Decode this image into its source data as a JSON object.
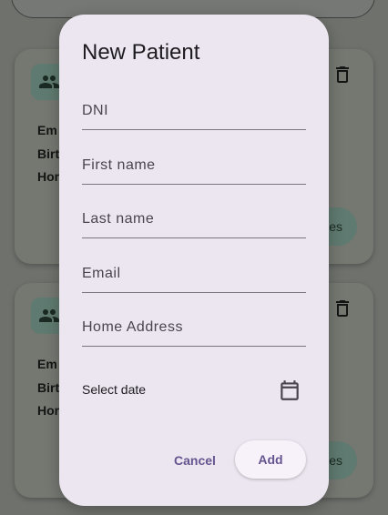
{
  "background": {
    "cards": [
      {
        "lines": [
          "Em",
          "Birt",
          "Hor"
        ],
        "button_label": "es"
      },
      {
        "lines": [
          "Em",
          "Birt",
          "Hor"
        ],
        "button_label": "es"
      }
    ],
    "icons": {
      "avatar": "people-icon",
      "delete": "trash-icon"
    }
  },
  "dialog": {
    "title": "New Patient",
    "fields": [
      {
        "name": "dni",
        "placeholder": "DNI",
        "value": ""
      },
      {
        "name": "first_name",
        "placeholder": "First name",
        "value": ""
      },
      {
        "name": "last_name",
        "placeholder": "Last name",
        "value": ""
      },
      {
        "name": "email",
        "placeholder": "Email",
        "value": ""
      },
      {
        "name": "home_address",
        "placeholder": "Home Address",
        "value": ""
      }
    ],
    "date_label": "Select date",
    "date_icon": "calendar-icon",
    "cancel_label": "Cancel",
    "add_label": "Add"
  },
  "colors": {
    "accent": "#65558f",
    "dialog_bg": "#ece6f0",
    "scrim": "#6f716d"
  }
}
